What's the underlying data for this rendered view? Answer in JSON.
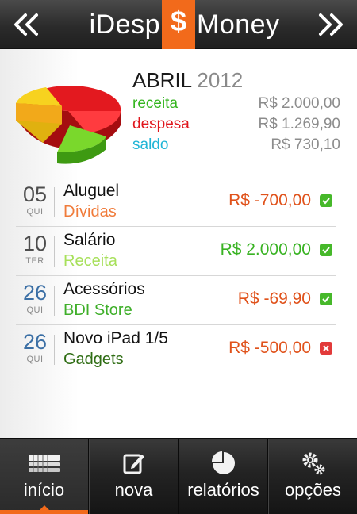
{
  "header": {
    "title_left": "iDesp",
    "title_symbol": "$",
    "title_right": "Money",
    "prev_icon": "double-chevron-left-icon",
    "next_icon": "double-chevron-right-icon",
    "accent": "#f26a1b"
  },
  "summary": {
    "month": "ABRIL",
    "year": "2012",
    "rows": [
      {
        "label": "receita",
        "value": "R$ 2.000,00",
        "color": "#33b51e"
      },
      {
        "label": "despesa",
        "value": "R$ 1.269,90",
        "color": "#e0161c"
      },
      {
        "label": "saldo",
        "value": "R$ 730,10",
        "color": "#1fb5d6"
      }
    ]
  },
  "transactions": [
    {
      "day": "05",
      "weekday": "QUI",
      "description": "Aluguel",
      "category": "Dívidas",
      "category_color": "#f07b3a",
      "amount": "R$ -700,00",
      "amount_color": "#e0521b",
      "status": "checked"
    },
    {
      "day": "10",
      "weekday": "TER",
      "description": "Salário",
      "category": "Receita",
      "category_color": "#a7e05a",
      "amount": "R$ 2.000,00",
      "amount_color": "#39b323",
      "status": "checked"
    },
    {
      "day": "26",
      "weekday": "QUI",
      "description": "Acessórios",
      "category": "BDI Store",
      "category_color": "#3faf2a",
      "amount": "R$ -69,90",
      "amount_color": "#e0521b",
      "status": "checked"
    },
    {
      "day": "26",
      "weekday": "QUI",
      "description": "Novo iPad 1/5",
      "category": "Gadgets",
      "category_color": "#2f6d14",
      "amount": "R$ -500,00",
      "amount_color": "#e0521b",
      "status": "unchecked"
    }
  ],
  "tabs": [
    {
      "label": "início",
      "icon": "money-stack-icon",
      "active": true
    },
    {
      "label": "nova",
      "icon": "edit-icon",
      "active": false
    },
    {
      "label": "relatórios",
      "icon": "pie-chart-icon",
      "active": false
    },
    {
      "label": "opções",
      "icon": "gears-icon",
      "active": false
    }
  ]
}
